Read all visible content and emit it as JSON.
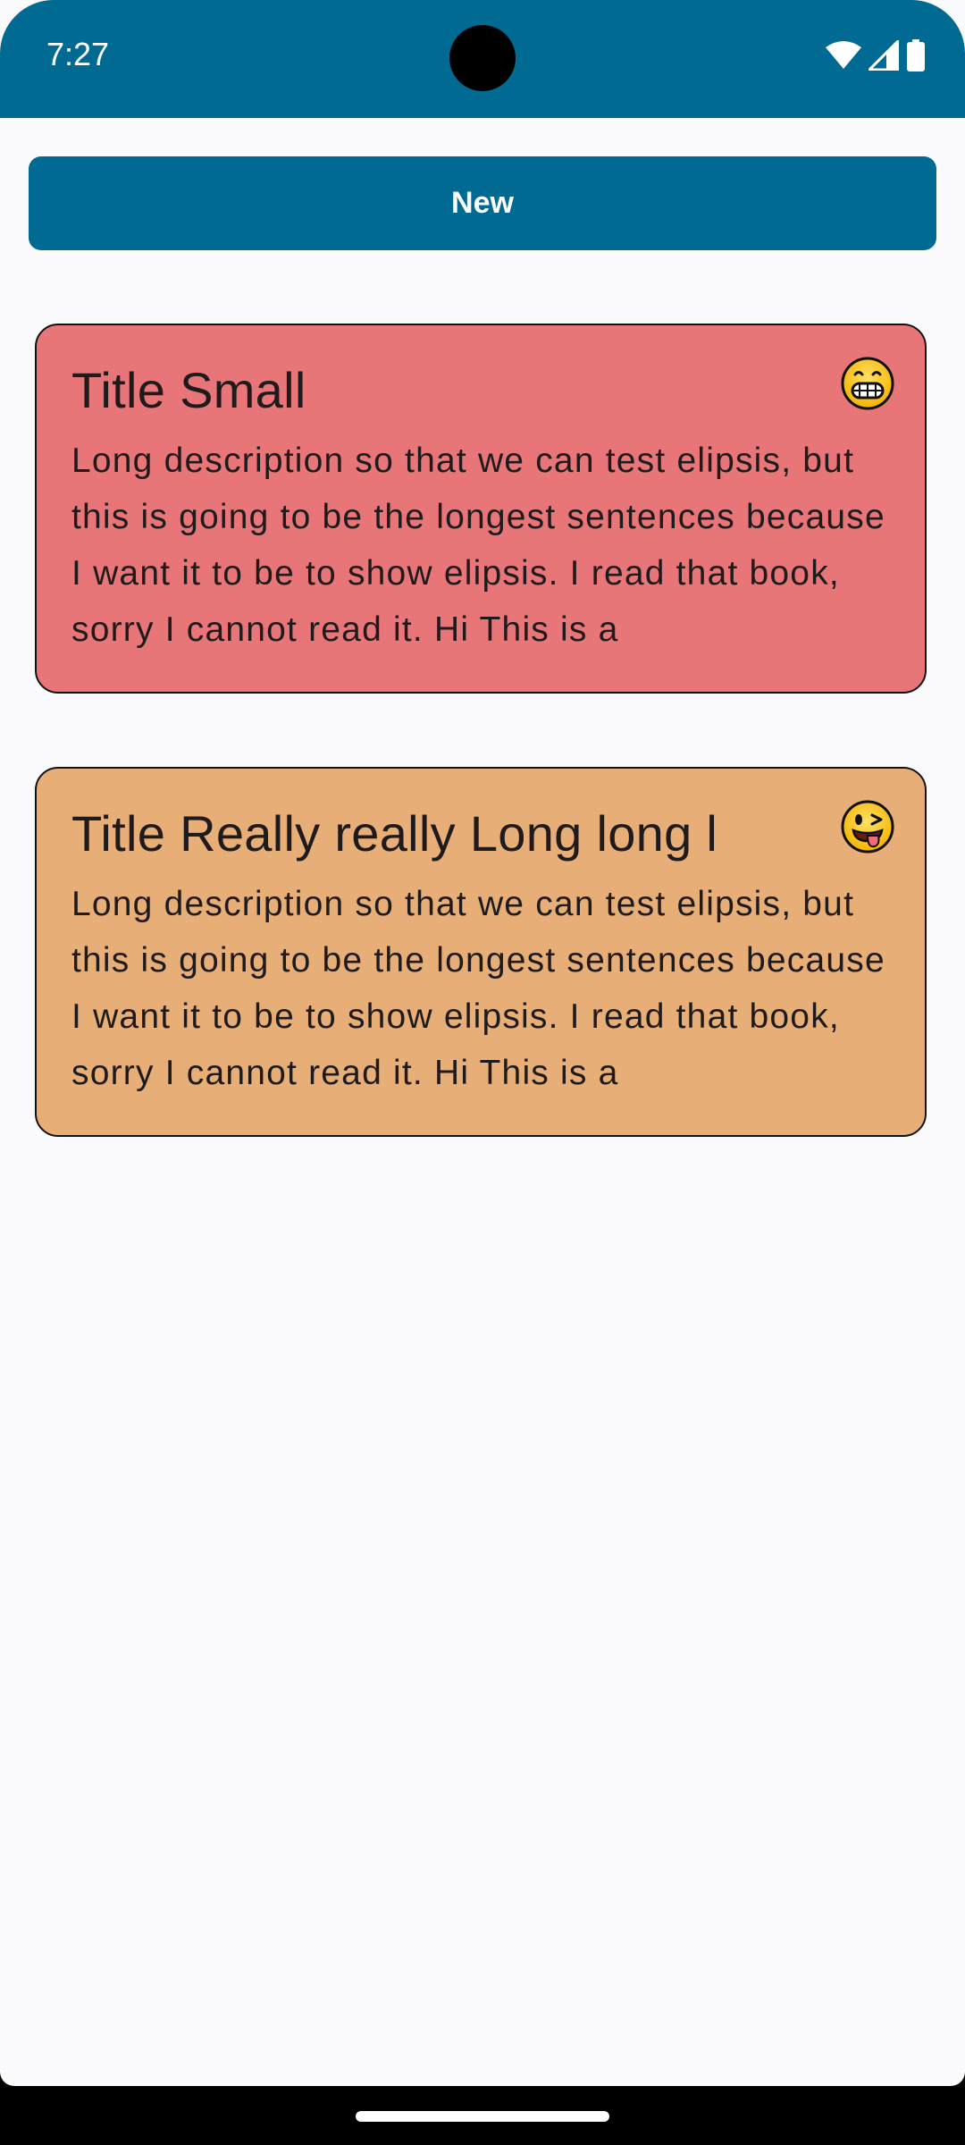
{
  "status_bar": {
    "time": "7:27",
    "icons": [
      "wifi-icon",
      "cell-signal-icon",
      "battery-icon"
    ],
    "color": "#006a92"
  },
  "toolbar": {
    "new_label": "New",
    "button_color": "#006a92"
  },
  "notes": [
    {
      "title": "Title Small",
      "description": "Long description so that we can test elipsis, but this is going to be the longest sentences because I want it to be to show elipsis.  I read that book, sorry I cannot read it.  Hi This is a ",
      "emoji": "grinning-face-icon",
      "color": "#e87578"
    },
    {
      "title": "Title Really really Long long l",
      "description": "Long description so that we can test elipsis, but this is going to be the longest sentences because I want it to be to show elipsis.  I read that book, sorry I cannot read it.  Hi This is a ",
      "emoji": "winking-tongue-face-icon",
      "color": "#e7ae77"
    }
  ]
}
